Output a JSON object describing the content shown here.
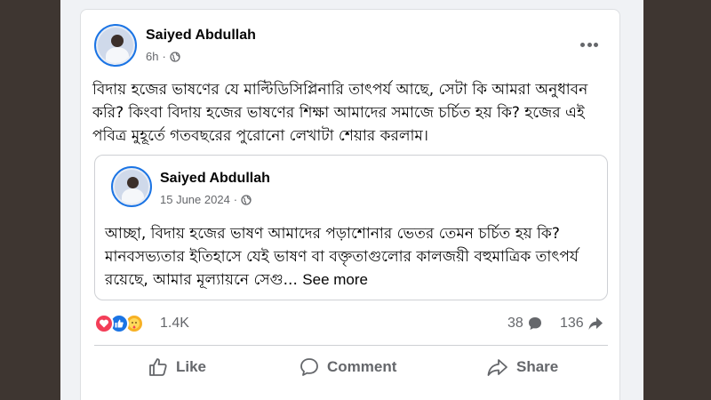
{
  "post": {
    "author": "Saiyed Abdullah",
    "time": "6h",
    "time_separator": "·",
    "privacy_icon": "globe-icon",
    "more_icon": "more-options-icon",
    "text": "বিদায় হজের ভাষণের যে মাল্টিডিসিপ্লিনারি তাৎপর্য আছে, সেটা কি আমরা অনুধাবন করি? কিংবা বিদায় হজের ভাষণের শিক্ষা আমাদের সমাজে চর্চিত হয় কি? হজের এই পবিত্র মুহূর্তে গতবছরের পুরোনো লেখাটা শেয়ার করলাম।"
  },
  "shared_post": {
    "author": "Saiyed Abdullah",
    "date": "15 June 2024",
    "time_separator": "·",
    "privacy_icon": "globe-icon",
    "text": "আচ্ছা, বিদায় হজের ভাষণ আমাদের পড়াশোনার ভেতর তেমন চর্চিত হয় কি? মানবসভ্যতার ইতিহাসে যেই ভাষণ বা বক্তৃতাগুলোর কালজয়ী বহুমাত্রিক তাৎপর্য রয়েছে, আমার মূল্যায়নে সেগু...",
    "see_more": "See more"
  },
  "stats": {
    "reaction_icons": [
      "love-reaction-icon",
      "like-reaction-icon",
      "care-reaction-icon"
    ],
    "reactions": "1.4K",
    "comments": "38",
    "shares": "136"
  },
  "actions": {
    "like": "Like",
    "comment": "Comment",
    "share": "Share"
  },
  "colors": {
    "brand": "#1b74e4",
    "text": "#050505",
    "secondary": "#65676b",
    "love": "#f33e58",
    "care": "#f7b125"
  }
}
